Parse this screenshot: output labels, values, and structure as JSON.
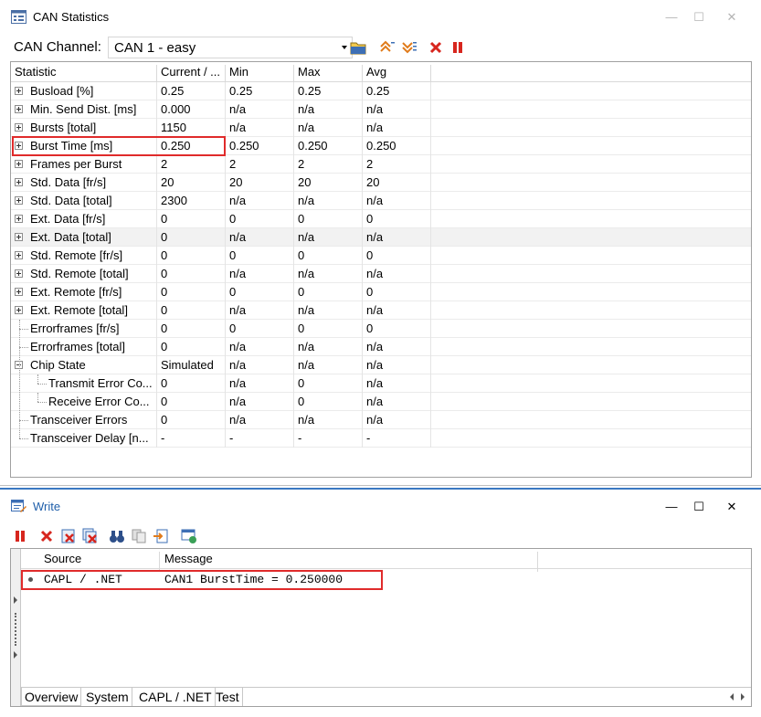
{
  "stats_window": {
    "title": "CAN Statistics",
    "channel_label": "CAN Channel:",
    "channel_value": "CAN 1 - easy",
    "columns": [
      "Statistic",
      "Current / ...",
      "Min",
      "Max",
      "Avg"
    ],
    "rows": [
      {
        "name": "Busload [%]",
        "current": "0.25",
        "min": "0.25",
        "max": "0.25",
        "avg": "0.25",
        "indent": 0,
        "kind": "plus"
      },
      {
        "name": "Min. Send Dist. [ms]",
        "current": "0.000",
        "min": "n/a",
        "max": "n/a",
        "avg": "n/a",
        "indent": 0,
        "kind": "plus"
      },
      {
        "name": "Bursts [total]",
        "current": "1150",
        "min": "n/a",
        "max": "n/a",
        "avg": "n/a",
        "indent": 0,
        "kind": "plus"
      },
      {
        "name": "Burst Time [ms]",
        "current": "0.250",
        "min": "0.250",
        "max": "0.250",
        "avg": "0.250",
        "indent": 0,
        "kind": "plus"
      },
      {
        "name": "Frames per Burst",
        "current": "2",
        "min": "2",
        "max": "2",
        "avg": "2",
        "indent": 0,
        "kind": "plus"
      },
      {
        "name": "Std. Data [fr/s]",
        "current": "20",
        "min": "20",
        "max": "20",
        "avg": "20",
        "indent": 0,
        "kind": "plus"
      },
      {
        "name": "Std. Data [total]",
        "current": "2300",
        "min": "n/a",
        "max": "n/a",
        "avg": "n/a",
        "indent": 0,
        "kind": "plus"
      },
      {
        "name": "Ext. Data [fr/s]",
        "current": "0",
        "min": "0",
        "max": "0",
        "avg": "0",
        "indent": 0,
        "kind": "plus"
      },
      {
        "name": "Ext. Data [total]",
        "current": "0",
        "min": "n/a",
        "max": "n/a",
        "avg": "n/a",
        "indent": 0,
        "kind": "plus"
      },
      {
        "name": "Std. Remote [fr/s]",
        "current": "0",
        "min": "0",
        "max": "0",
        "avg": "0",
        "indent": 0,
        "kind": "plus"
      },
      {
        "name": "Std. Remote [total]",
        "current": "0",
        "min": "n/a",
        "max": "n/a",
        "avg": "n/a",
        "indent": 0,
        "kind": "plus"
      },
      {
        "name": "Ext. Remote [fr/s]",
        "current": "0",
        "min": "0",
        "max": "0",
        "avg": "0",
        "indent": 0,
        "kind": "plus"
      },
      {
        "name": "Ext. Remote [total]",
        "current": "0",
        "min": "n/a",
        "max": "n/a",
        "avg": "n/a",
        "indent": 0,
        "kind": "plus"
      },
      {
        "name": "Errorframes [fr/s]",
        "current": "0",
        "min": "0",
        "max": "0",
        "avg": "0",
        "indent": 0,
        "kind": "leaf"
      },
      {
        "name": "Errorframes [total]",
        "current": "0",
        "min": "n/a",
        "max": "n/a",
        "avg": "n/a",
        "indent": 0,
        "kind": "leaf"
      },
      {
        "name": "Chip State",
        "current": "Simulated",
        "min": "n/a",
        "max": "n/a",
        "avg": "n/a",
        "indent": 0,
        "kind": "minus"
      },
      {
        "name": "Transmit Error Co...",
        "current": "0",
        "min": "n/a",
        "max": "0",
        "avg": "n/a",
        "indent": 1,
        "kind": "leaf"
      },
      {
        "name": "Receive Error Co...",
        "current": "0",
        "min": "n/a",
        "max": "0",
        "avg": "n/a",
        "indent": 1,
        "kind": "leaf"
      },
      {
        "name": "Transceiver Errors",
        "current": "0",
        "min": "n/a",
        "max": "n/a",
        "avg": "n/a",
        "indent": 0,
        "kind": "leaf"
      },
      {
        "name": "Transceiver Delay [n...",
        "current": "-",
        "min": "-",
        "max": "-",
        "avg": "-",
        "indent": 0,
        "kind": "leaf"
      }
    ]
  },
  "write_window": {
    "title": "Write",
    "columns": [
      "Source",
      "Message"
    ],
    "rows": [
      {
        "source": "CAPL / .NET",
        "message": "CAN1 BurstTime = 0.250000"
      }
    ],
    "tabs": [
      "Overview",
      "System",
      "CAPL / .NET",
      "Test"
    ],
    "active_tab": "Overview"
  },
  "window_controls": {
    "minimize": "—",
    "maximize": "☐",
    "close": "✕"
  },
  "colors": {
    "highlight": "#e02b2b",
    "write_title": "#1f5faa",
    "accent_border": "#3a78c2"
  }
}
